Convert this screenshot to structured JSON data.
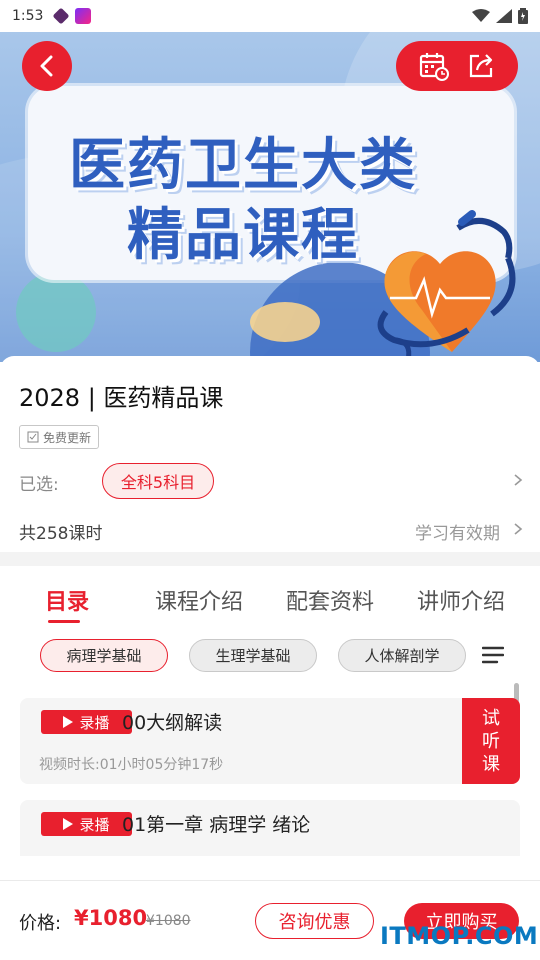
{
  "status_bar": {
    "time": "1:53",
    "icons": [
      "app-icon",
      "app-icon",
      "wifi-icon",
      "signal-icon",
      "battery-icon"
    ]
  },
  "banner": {
    "title_line1": "医药卫生大类",
    "title_line2": "精品课程",
    "colors": {
      "title": "#2f5fbf",
      "heart": "#f07a2a",
      "accent": "#e8202e"
    }
  },
  "header_actions": {
    "icons": [
      "back-icon",
      "calendar-icon",
      "share-icon"
    ]
  },
  "course": {
    "title": "2028 | 医药精品课",
    "update_tag": "免费更新",
    "selected_label": "已选:",
    "selected_value": "全科5科目",
    "lessons_count": "共258课时",
    "validity_label": "学习有效期"
  },
  "tabs": [
    {
      "label": "目录",
      "active": true
    },
    {
      "label": "课程介绍",
      "active": false
    },
    {
      "label": "配套资料",
      "active": false
    },
    {
      "label": "讲师介绍",
      "active": false
    }
  ],
  "subjects": [
    {
      "label": "病理学基础",
      "active": true
    },
    {
      "label": "生理学基础",
      "active": false
    },
    {
      "label": "人体解剖学",
      "active": false
    }
  ],
  "lessons": [
    {
      "badge": "录播",
      "title": "00大纲解读",
      "duration": "视频时长:01小时05分钟17秒",
      "trial": [
        "试",
        "听",
        "课"
      ]
    },
    {
      "badge": "录播",
      "title": "01第一章 病理学 绪论"
    }
  ],
  "bottom_bar": {
    "price_label": "价格:",
    "price": "¥1080",
    "original_price": "¥1080",
    "consult_label": "咨询优惠",
    "buy_label": "立即购买"
  },
  "watermark": "ITMOP.COM"
}
